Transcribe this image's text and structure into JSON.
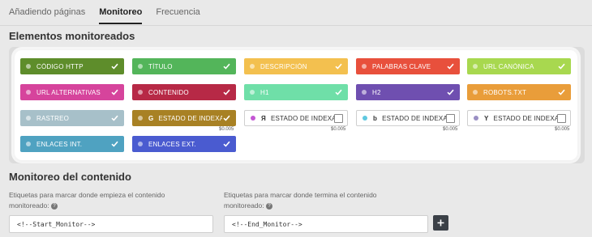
{
  "tabs": [
    {
      "label": "Añadiendo páginas",
      "active": false
    },
    {
      "label": "Monitoreo",
      "active": true
    },
    {
      "label": "Frecuencia",
      "active": false
    }
  ],
  "section_elements_title": "Elementos monitoreados",
  "chips": [
    {
      "label": "CÓDIGO HTTP",
      "color": "#5e8d2b",
      "checked": true
    },
    {
      "label": "TÍTULO",
      "color": "#53b55a",
      "checked": true
    },
    {
      "label": "DESCRIPCIÓN",
      "color": "#f3c04f",
      "checked": true
    },
    {
      "label": "PALABRAS CLAVE",
      "color": "#e8503c",
      "checked": true
    },
    {
      "label": "URL CANÓNICA",
      "color": "#a8d84f",
      "checked": true
    },
    {
      "label": "URL ALTERNATIVAS",
      "color": "#d6449c",
      "checked": true
    },
    {
      "label": "CONTENIDO",
      "color": "#b72946",
      "checked": true
    },
    {
      "label": "H1",
      "color": "#6fdfa8",
      "checked": true
    },
    {
      "label": "H2",
      "color": "#6f4fb0",
      "checked": true
    },
    {
      "label": "ROBOTS.TXT",
      "color": "#e99d3a",
      "checked": true
    },
    {
      "label": "RASTREO",
      "color": "#a7c0c9",
      "checked": true
    },
    {
      "label": "ESTADO DE INDEXACIÓN",
      "color": "#a88124",
      "checked": true,
      "glyph": "G"
    },
    {
      "label": "ESTADO DE INDEXACIÓN",
      "outline": true,
      "dot": "#c456d4",
      "glyph": "Я",
      "price": "$0.005"
    },
    {
      "label": "ESTADO DE INDEXACIÓN",
      "outline": true,
      "dot": "#5fc8e0",
      "glyph": "b",
      "price": "$0.005"
    },
    {
      "label": "ESTADO DE INDEXACIÓN",
      "outline": true,
      "dot": "#9a8fc4",
      "glyph": "Y",
      "price": "$0.005"
    },
    {
      "label": "ENLACES INT.",
      "color": "#4fa2c1",
      "checked": true
    },
    {
      "label": "ENLACES EXT.",
      "color": "#4a5bd0",
      "checked": true
    }
  ],
  "google_price": "$0.005",
  "section_content_title": "Monitoreo del contenido",
  "start_field": {
    "label": "Etiquetas para marcar donde empieza el contenido monitoreado:",
    "value": "<!--Start_Monitor-->"
  },
  "end_field": {
    "label": "Etiquetas para marcar donde termina el contenido monitoreado:",
    "value": "<!--End_Monitor-->"
  },
  "help_glyph": "?",
  "check_icon": "check-icon",
  "add_icon": "plus-icon"
}
